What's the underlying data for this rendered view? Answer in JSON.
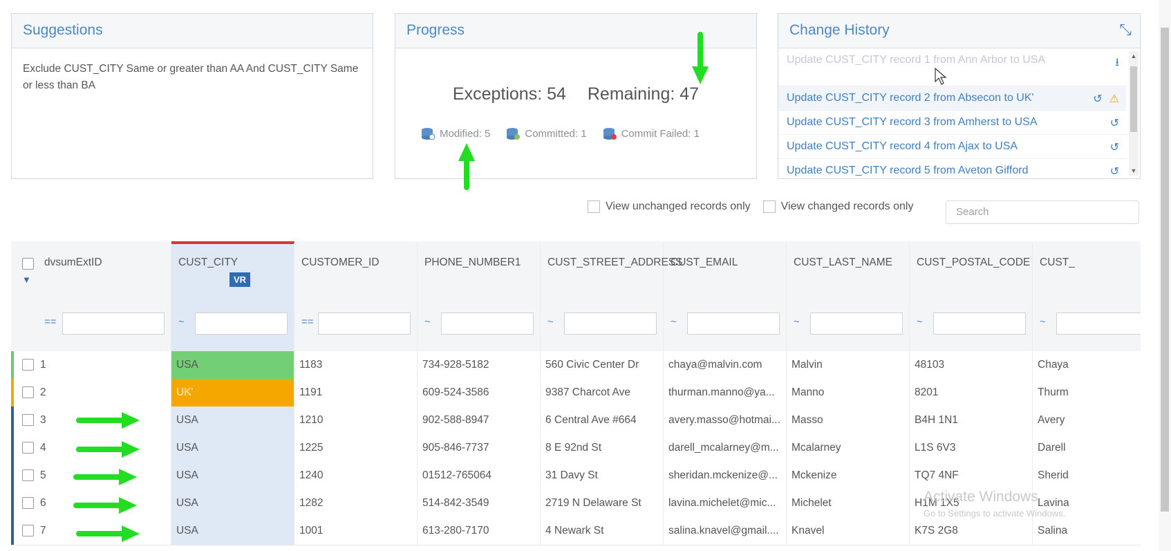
{
  "suggestions": {
    "title": "Suggestions",
    "text": "Exclude CUST_CITY Same or greater than AA And CUST_CITY Same or less than BA"
  },
  "progress": {
    "title": "Progress",
    "exceptions": "Exceptions: 54",
    "remaining": "Remaining: 47",
    "modified": "Modified: 5",
    "committed": "Committed: 1",
    "commit_failed": "Commit Failed: 1"
  },
  "history": {
    "title": "Change History",
    "items": [
      "Update CUST_CITY record 1 from Ann Arbor to USA",
      "Update CUST_CITY record 2 from Absecon to UK'",
      "Update CUST_CITY record 3 from Amherst to USA",
      "Update CUST_CITY record 4 from Ajax to USA",
      "Update CUST_CITY record 5 from Aveton Gifford"
    ]
  },
  "filters": {
    "unchanged": "View unchanged records only",
    "changed": "View changed records only",
    "search_placeholder": "Search"
  },
  "grid": {
    "columns": [
      "dvsumExtID",
      "CUST_CITY",
      "CUSTOMER_ID",
      "PHONE_NUMBER1",
      "CUST_STREET_ADDRESS",
      "CUST_EMAIL",
      "CUST_LAST_NAME",
      "CUST_POSTAL_CODE",
      "CUST_"
    ],
    "vr_badge": "VR",
    "filter_ops": [
      "==",
      "~",
      "==",
      "~",
      "~",
      "~",
      "~",
      "~",
      "~"
    ],
    "rows": [
      [
        "1",
        "USA",
        "1183",
        "734-928-5182",
        "560 Civic Center Dr",
        "chaya@malvin.com",
        "Malvin",
        "48103",
        "Chaya"
      ],
      [
        "2",
        "UK'",
        "1191",
        "609-524-3586",
        "9387 Charcot Ave",
        "thurman.manno@ya...",
        "Manno",
        "8201",
        "Thurm"
      ],
      [
        "3",
        "USA",
        "1210",
        "902-588-8947",
        "6 Central Ave #664",
        "avery.masso@hotmai...",
        "Masso",
        "B4H 1N1",
        "Avery"
      ],
      [
        "4",
        "USA",
        "1225",
        "905-846-7737",
        "8 E 92nd St",
        "darell_mcalarney@m...",
        "Mcalarney",
        "L1S 6V3",
        "Darell"
      ],
      [
        "5",
        "USA",
        "1240",
        "01512-765064",
        "31 Davy St",
        "sheridan.mckenize@...",
        "Mckenize",
        "TQ7 4NF",
        "Sherid"
      ],
      [
        "6",
        "USA",
        "1282",
        "514-842-3549",
        "2719 N Delaware St",
        "lavina.michelet@mic...",
        "Michelet",
        "H1M 1X5",
        "Lavina"
      ],
      [
        "7",
        "USA",
        "1001",
        "613-280-7170",
        "4 Newark St",
        "salina.knavel@gmail....",
        "Knavel",
        "K7S 2G8",
        "Salina"
      ]
    ],
    "row_markers": [
      "#6cc96f",
      "#f5a700",
      "#2f5f97",
      "#2f5f97",
      "#2f5f97",
      "#2f5f97",
      "#2f5f97"
    ]
  },
  "watermark": {
    "title": "Activate Windows",
    "sub": "Go to Settings to activate Windows."
  },
  "colors": {
    "accent": "#4f87c3",
    "green": "#72cf76",
    "orange": "#f5a700",
    "selected_col": "#dfe9f5",
    "annot_arrow": "#22dd22"
  }
}
